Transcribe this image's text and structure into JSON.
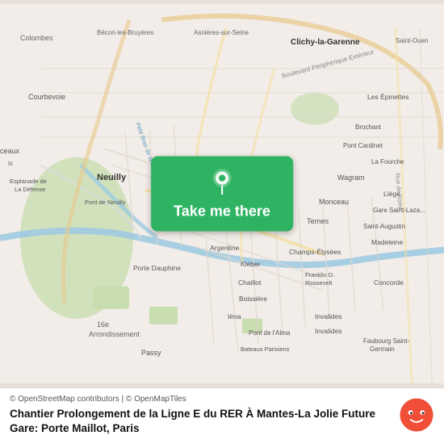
{
  "map": {
    "background_color": "#e8e0d8"
  },
  "button": {
    "label": "Take me there",
    "bg_color": "#2db362",
    "pin_icon": "location-pin-icon"
  },
  "footer": {
    "attribution": "© OpenStreetMap contributors | © OpenMapTiles",
    "location_title": "Chantier Prolongement de la Ligne E du RER À Mantes-La Jolie Future Gare: Porte Maillot, Paris",
    "moovit_logo": "moovit-logo"
  }
}
